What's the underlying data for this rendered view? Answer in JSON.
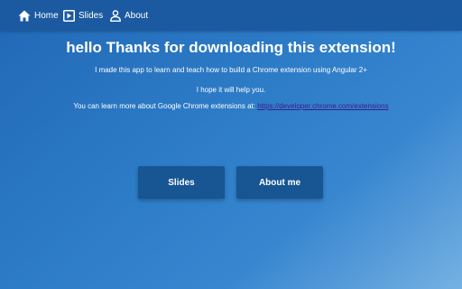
{
  "nav": {
    "items": [
      {
        "label": "Home",
        "icon": "home-icon"
      },
      {
        "label": "Slides",
        "icon": "slides-icon"
      },
      {
        "label": "About",
        "icon": "person-icon"
      }
    ]
  },
  "main": {
    "title": "hello Thanks for downloading this extension!",
    "intro": "I made this app to learn and teach how to build a Chrome extension using Angular 2+",
    "hope": "I hope it will help you.",
    "learn_more_text": "You can learn more about Google Chrome extensions at:",
    "learn_more_link": "https://developer.chrome.com/extensions"
  },
  "buttons": {
    "slides_label": "Slides",
    "about_label": "About me"
  },
  "colors": {
    "nav_background": "#1b5aa0",
    "button_background": "#175593",
    "link": "#3b1e8a",
    "text": "#ffffff"
  }
}
